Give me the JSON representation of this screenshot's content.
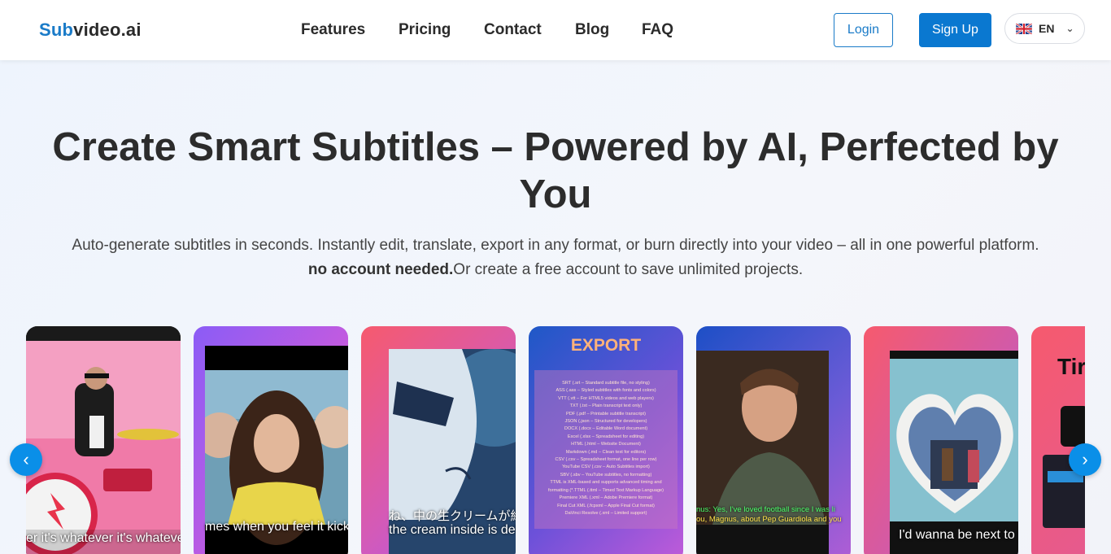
{
  "brand": {
    "part1": "Sub",
    "part2": "video.ai"
  },
  "nav": [
    "Features",
    "Pricing",
    "Contact",
    "Blog",
    "FAQ"
  ],
  "auth": {
    "login": "Login",
    "signup": "Sign Up"
  },
  "language": {
    "code": "EN",
    "flag": "uk-flag-icon"
  },
  "hero": {
    "title": "Create Smart Subtitles – Powered by AI, Perfected by You",
    "subtitle": "Auto-generate subtitles in seconds. Instantly edit, translate, export in any format, or burn directly into your video – all in one powerful platform.",
    "bold_note": "no account needed.",
    "note_rest": "Or create a free account to save unlimited projects."
  },
  "carousel": {
    "captions": [
      "er it's whatever it's whatever",
      "mes when you feel it kick",
      "ね、中の生クリームが絶品",
      "the cream inside is deli",
      "nus: Yes, I've loved football since I was li",
      "ou, Magnus, about Pep Guardiola and you",
      "I'd wanna be next to y",
      "Tir"
    ],
    "export_title": "EXPORT",
    "export_formats": [
      "SRT (.srt – Standard subtitle file, no styling)",
      "ASS (.ass – Styled subtitles with fonts and colors)",
      "VTT (.vtt – For HTML5 videos and web players)",
      "TXT (.txt – Plain transcript text only)",
      "PDF (.pdf – Printable subtitle transcript)",
      "JSON (.json – Structured for developers)",
      "DOCX (.docx – Editable Word document)",
      "Excel (.xlsx – Spreadsheet for editing)",
      "HTML (.html – Website Document)",
      "Markdown (.md – Clean text for editors)",
      "CSV (.csv – Spreadsheet format, one line per row)",
      "YouTube CSV (.csv – Auto Subtitles import)",
      "SBV (.sbv – YouTube subtitles, no formatting)",
      "TTML is XML-based and supports advanced timing and",
      "formatting (*.TTML (.ttml – Timed Text Markup Language)",
      "Premiere XML (.xml – Adobe Premiere format)",
      "Final Cut XML (.fcpxml – Apple Final Cut format)",
      "DaVinci Resolve (.xml – Limited support)"
    ],
    "prev": "‹",
    "next": "›"
  },
  "colors": {
    "accent": "#0a78d0",
    "brand_blue": "#1a7bc8",
    "arrow": "#0a8fe8"
  }
}
